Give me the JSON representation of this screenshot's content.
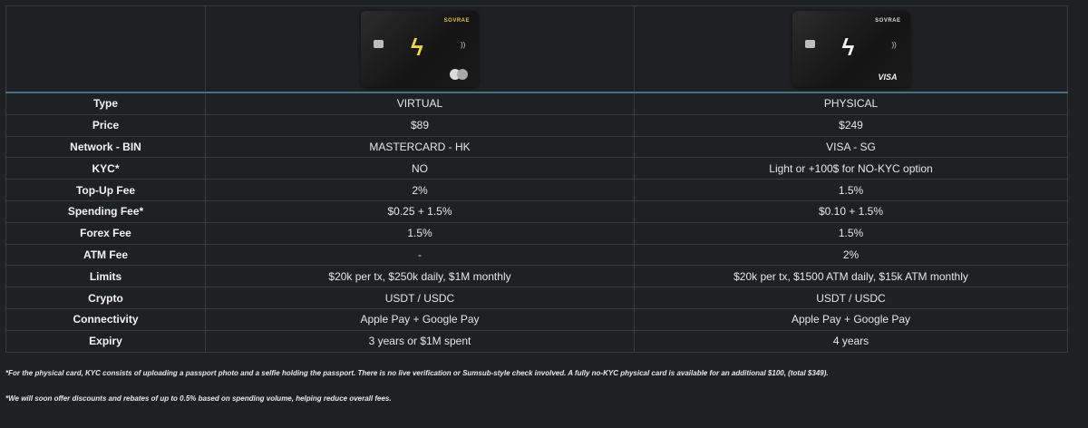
{
  "cards": {
    "virtual": {
      "brand": "SOVRAE",
      "logo_glyph": "ϟ",
      "logo_color": "#e8d54a",
      "nfc_glyph": "))",
      "network_mark": "mastercard-logo"
    },
    "physical": {
      "brand": "SOVRAE",
      "logo_glyph": "ϟ",
      "logo_color": "#f2f2f2",
      "nfc_glyph": "))",
      "network_mark": "VISA"
    }
  },
  "rows": [
    {
      "label": "Type",
      "virtual": "VIRTUAL",
      "physical": "PHYSICAL"
    },
    {
      "label": "Price",
      "virtual": "$89",
      "physical": "$249"
    },
    {
      "label": "Network - BIN",
      "virtual": "MASTERCARD - HK",
      "physical": "VISA - SG"
    },
    {
      "label": "KYC*",
      "virtual": "NO",
      "physical": "Light or +100$ for NO-KYC option"
    },
    {
      "label": "Top-Up Fee",
      "virtual": "2%",
      "physical": "1.5%"
    },
    {
      "label": "Spending Fee*",
      "virtual": "$0.25 + 1.5%",
      "physical": "$0.10 + 1.5%"
    },
    {
      "label": "Forex Fee",
      "virtual": "1.5%",
      "physical": "1.5%"
    },
    {
      "label": "ATM Fee",
      "virtual": "-",
      "physical": "2%"
    },
    {
      "label": "Limits",
      "virtual": "$20k per tx, $250k daily, $1M monthly",
      "physical": "$20k per tx, $1500 ATM daily, $15k ATM monthly"
    },
    {
      "label": "Crypto",
      "virtual": "USDT / USDC",
      "physical": "USDT / USDC"
    },
    {
      "label": "Connectivity",
      "virtual": "Apple Pay + Google Pay",
      "physical": "Apple Pay + Google Pay"
    },
    {
      "label": "Expiry",
      "virtual": "3 years or $1M spent",
      "physical": "4 years"
    }
  ],
  "footnotes": [
    "*For the physical card, KYC consists of uploading a passport photo and a selfie holding the passport. There is no live verification or Sumsub-style check involved. A fully no-KYC physical card is available for an additional $100, (total $349).",
    "*We will soon offer discounts and rebates of up to 0.5% based on spending volume, helping reduce overall fees."
  ]
}
